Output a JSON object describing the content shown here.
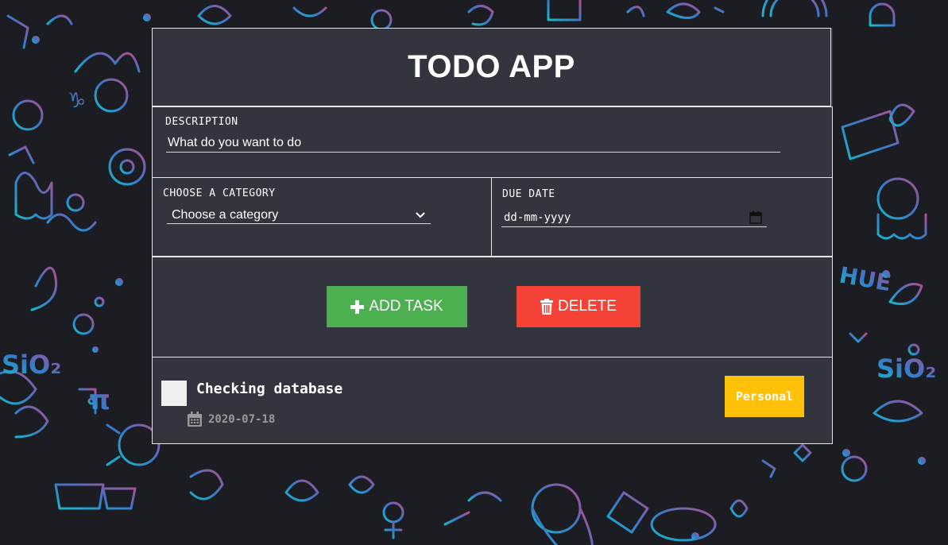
{
  "app": {
    "title": "TODO APP"
  },
  "form": {
    "description_label": "DESCRIPTION",
    "description_value": "What do you want to do",
    "category_label": "CHOOSE A CATEGORY",
    "category_selected": "Choose a category",
    "due_date_label": "DUE DATE",
    "due_date_value": "dd-mm-yyyy"
  },
  "buttons": {
    "add_label": "ADD TASK",
    "delete_label": "DELETE"
  },
  "tasks": [
    {
      "name": "Checking database",
      "date": "2020-07-18",
      "category": "Personal",
      "done": false
    }
  ],
  "colors": {
    "panel": "#32353d",
    "add": "#4caf50",
    "delete": "#f44336",
    "personal_badge": "#ffc107",
    "border": "#e6e6e6"
  },
  "icons": [
    "plus-icon",
    "trash-icon",
    "chevron-down-icon",
    "calendar-icon"
  ]
}
